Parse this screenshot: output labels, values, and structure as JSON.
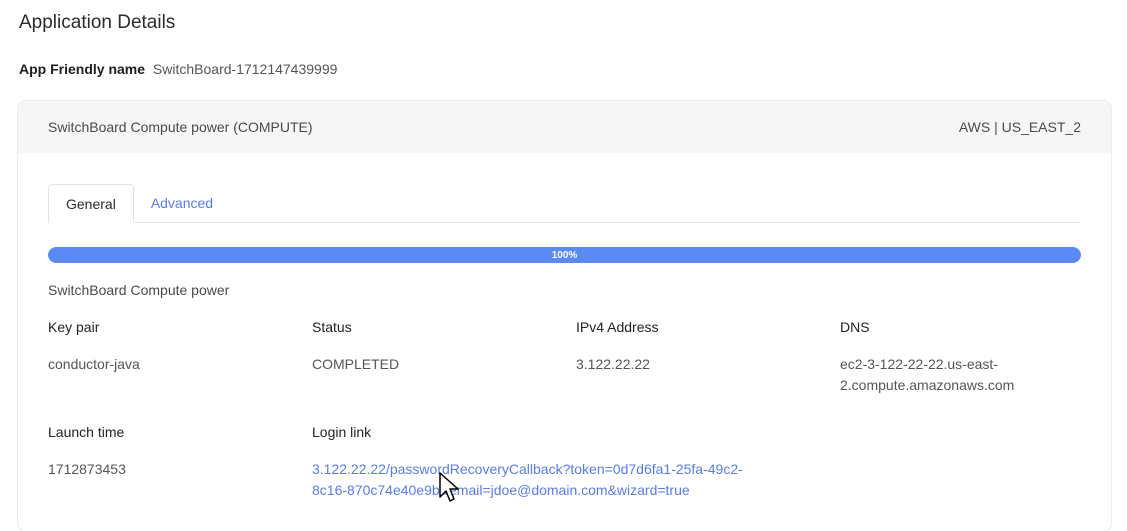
{
  "page": {
    "title": "Application Details"
  },
  "app": {
    "friendly_label": "App Friendly name",
    "friendly_value": "SwitchBoard-1712147439999"
  },
  "card": {
    "header_left": "SwitchBoard Compute power (COMPUTE)",
    "header_right": "AWS | US_EAST_2"
  },
  "tabs": [
    {
      "label": "General",
      "active": true
    },
    {
      "label": "Advanced",
      "active": false
    }
  ],
  "progress": {
    "value": 100,
    "label": "100%"
  },
  "resource_name": "SwitchBoard Compute power",
  "fields": {
    "key_pair": {
      "label": "Key pair",
      "value": "conductor-java"
    },
    "status": {
      "label": "Status",
      "value": "COMPLETED"
    },
    "ipv4": {
      "label": "IPv4 Address",
      "value": "3.122.22.22"
    },
    "dns": {
      "label": "DNS",
      "value_line1": "ec2-3-122-22-22.us-east-",
      "value_line2": "2.compute.amazonaws.com"
    },
    "launch_time": {
      "label": "Launch time",
      "value": "1712873453"
    },
    "login_link": {
      "label": "Login link",
      "value_line1": "3.122.22.22/passwordRecoveryCallback?token=0d7d6fa1-25fa-49c2-",
      "value_line2": "8c16-870c74e40e9b&email=jdoe@domain.com&wizard=true"
    }
  },
  "colors": {
    "accent": "#5b8af5",
    "link": "#5a7be6",
    "header_bg": "#f6f6f6"
  }
}
